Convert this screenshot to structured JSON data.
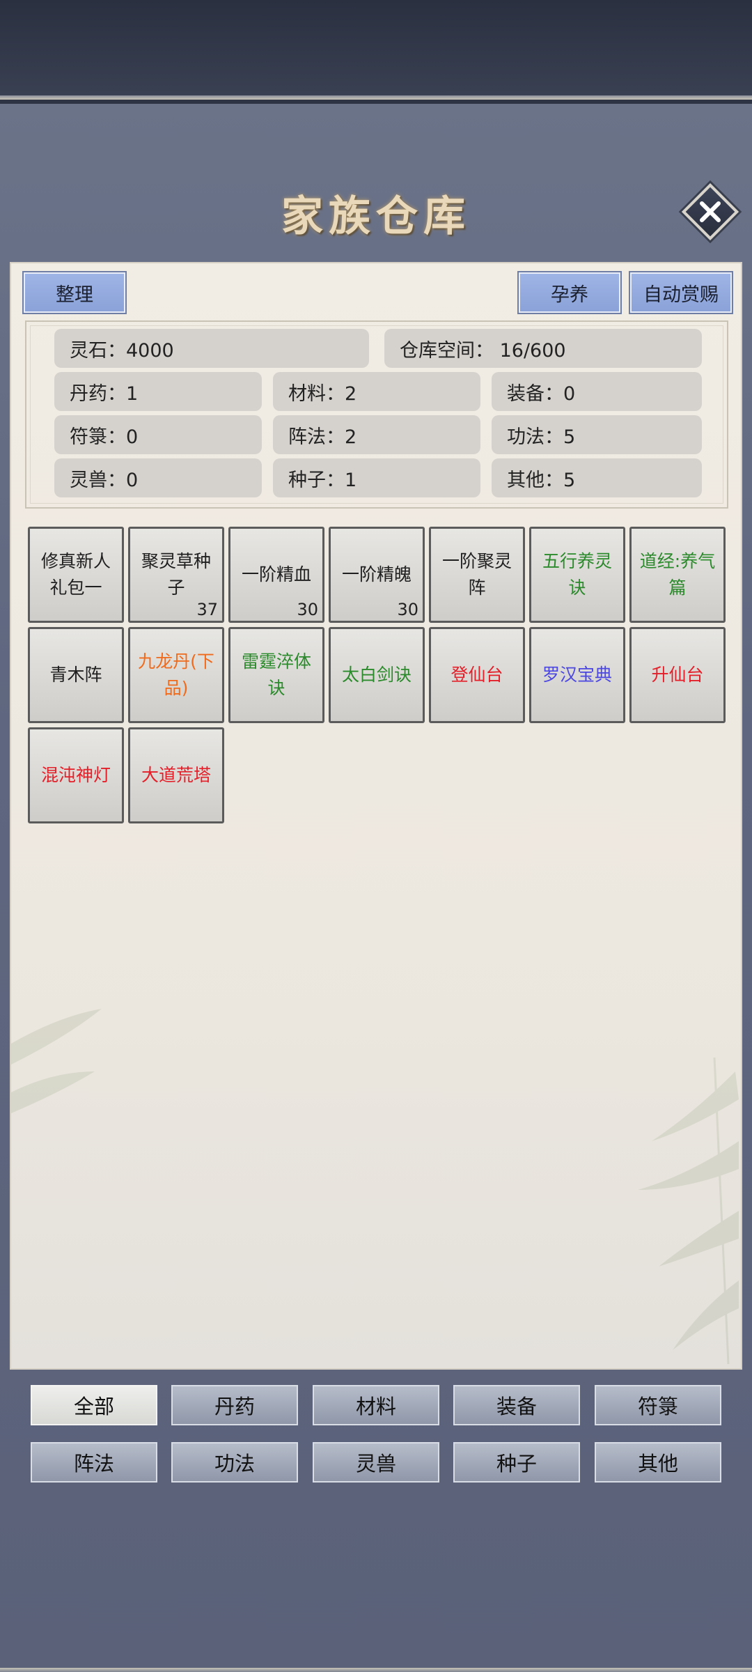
{
  "header": {
    "title": "家族仓库",
    "close_icon": "close-x-icon"
  },
  "toolbar": {
    "sort_label": "整理",
    "breed_label": "孕养",
    "auto_reward_label": "自动赏赐"
  },
  "stats": {
    "spirit_stone": "灵石：4000",
    "capacity": "仓库空间：   16/600",
    "pills": "丹药：1",
    "materials": "材料：2",
    "equipment": "装备：0",
    "talismans": "符箓：0",
    "formations": "阵法：2",
    "techniques": "功法：5",
    "beasts": "灵兽：0",
    "seeds": "种子：1",
    "others": "其他：5"
  },
  "items": [
    {
      "name": "修真新人礼包一",
      "qty": "",
      "color": "#1f1f1f"
    },
    {
      "name": "聚灵草种子",
      "qty": "37",
      "color": "#1f1f1f"
    },
    {
      "name": "一阶精血",
      "qty": "30",
      "color": "#1f1f1f"
    },
    {
      "name": "一阶精魄",
      "qty": "30",
      "color": "#1f1f1f"
    },
    {
      "name": "一阶聚灵阵",
      "qty": "",
      "color": "#1f1f1f"
    },
    {
      "name": "五行养灵诀",
      "qty": "",
      "color": "#2b8a2b"
    },
    {
      "name": "道经:养气篇",
      "qty": "",
      "color": "#2b8a2b"
    },
    {
      "name": "青木阵",
      "qty": "",
      "color": "#1f1f1f"
    },
    {
      "name": "九龙丹(下品)",
      "qty": "",
      "color": "#f06a1c"
    },
    {
      "name": "雷霆淬体诀",
      "qty": "",
      "color": "#2b8a2b"
    },
    {
      "name": "太白剑诀",
      "qty": "",
      "color": "#2b8a2b"
    },
    {
      "name": "登仙台",
      "qty": "",
      "color": "#e3202a"
    },
    {
      "name": "罗汉宝典",
      "qty": "",
      "color": "#4b47e0"
    },
    {
      "name": "升仙台",
      "qty": "",
      "color": "#e3202a"
    },
    {
      "name": "混沌神灯",
      "qty": "",
      "color": "#e3202a"
    },
    {
      "name": "大道荒塔",
      "qty": "",
      "color": "#e3202a"
    }
  ],
  "categories": {
    "all": "全部",
    "pills": "丹药",
    "materials": "材料",
    "equipment": "装备",
    "talismans": "符箓",
    "formations": "阵法",
    "techniques": "功法",
    "beasts": "灵兽",
    "seeds": "种子",
    "others": "其他",
    "active": "全部"
  }
}
